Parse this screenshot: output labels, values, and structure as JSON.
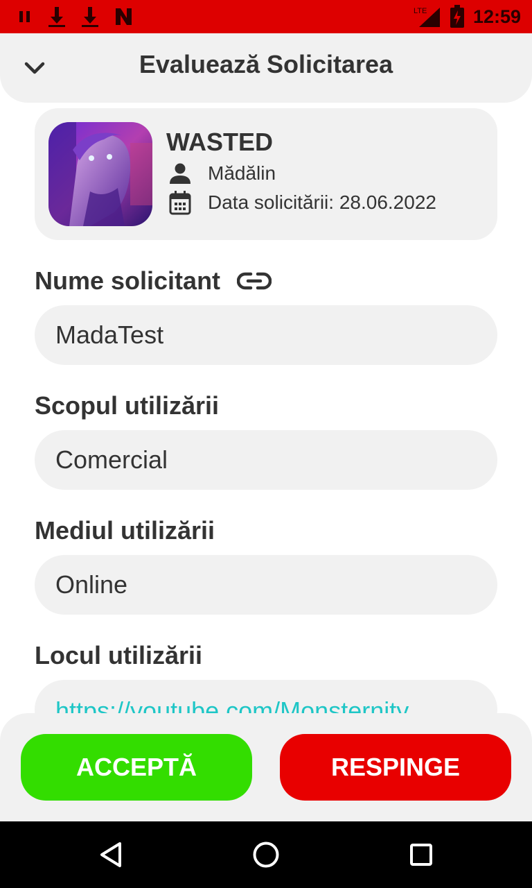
{
  "status_bar": {
    "time": "12:59",
    "network": "LTE",
    "icons": [
      "pause-icon",
      "download-icon",
      "download-icon",
      "netflix-icon",
      "signal-icon",
      "battery-icon"
    ]
  },
  "header": {
    "title": "Evaluează Solicitarea",
    "back_icon": "chevron-down-icon"
  },
  "request": {
    "title": "WASTED",
    "user": "Mădălin",
    "date": "Data solicitării: 28.06.2022"
  },
  "fields": {
    "requester_label": "Nume solicitant",
    "requester_value": "MadaTest",
    "purpose_label": "Scopul utilizării",
    "purpose_value": "Comercial",
    "medium_label": "Mediul utilizării",
    "medium_value": "Online",
    "place_label": "Locul utilizării",
    "place_value": "https://youtube.com/Monsternity"
  },
  "actions": {
    "accept_label": "ACCEPTĂ",
    "reject_label": "RESPINGE"
  },
  "colors": {
    "status_bar": "#dd0000",
    "accept": "#33dd00",
    "reject": "#e80000",
    "link": "#1ec6c6",
    "surface": "#f1f1f1"
  }
}
